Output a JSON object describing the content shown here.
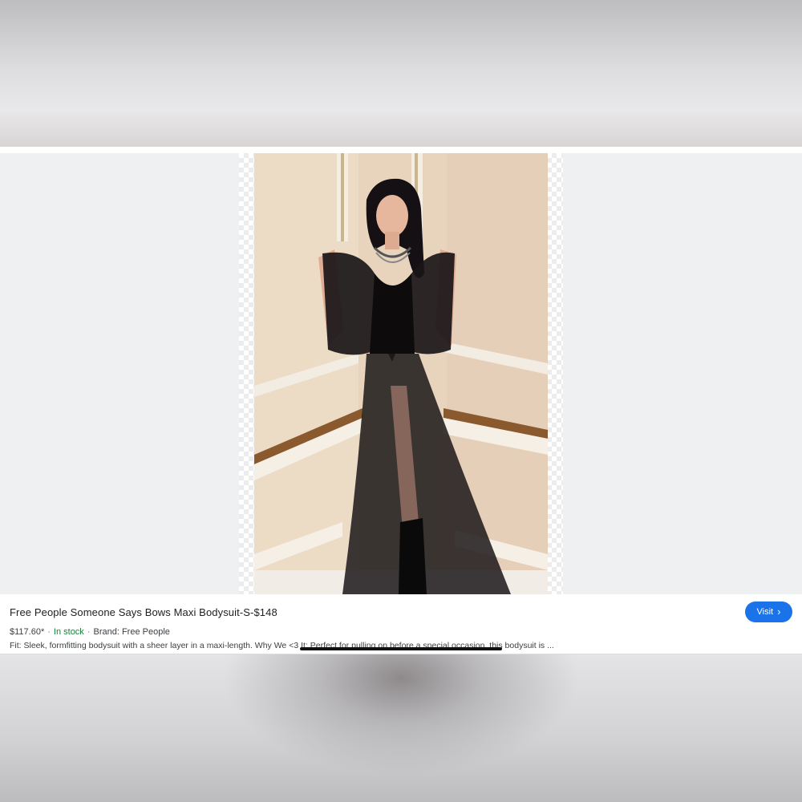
{
  "product": {
    "title": "Free People Someone Says Bows Maxi Bodysuit-S-$148",
    "price": "$117.60*",
    "stock": "In stock",
    "brand": "Brand: Free People",
    "description": "Fit: Sleek, formfitting bodysuit with a sheer layer in a maxi-length. Why We <3 It: Perfect for pulling on before a special occasion, this bodysuit is ...",
    "image_alt": "model wearing black sheer bow maxi bodysuit"
  },
  "actions": {
    "visit_label": "Visit",
    "visit_icon": "chevron-right-icon"
  },
  "colors": {
    "accent": "#1a73e8",
    "stock": "#188038"
  }
}
